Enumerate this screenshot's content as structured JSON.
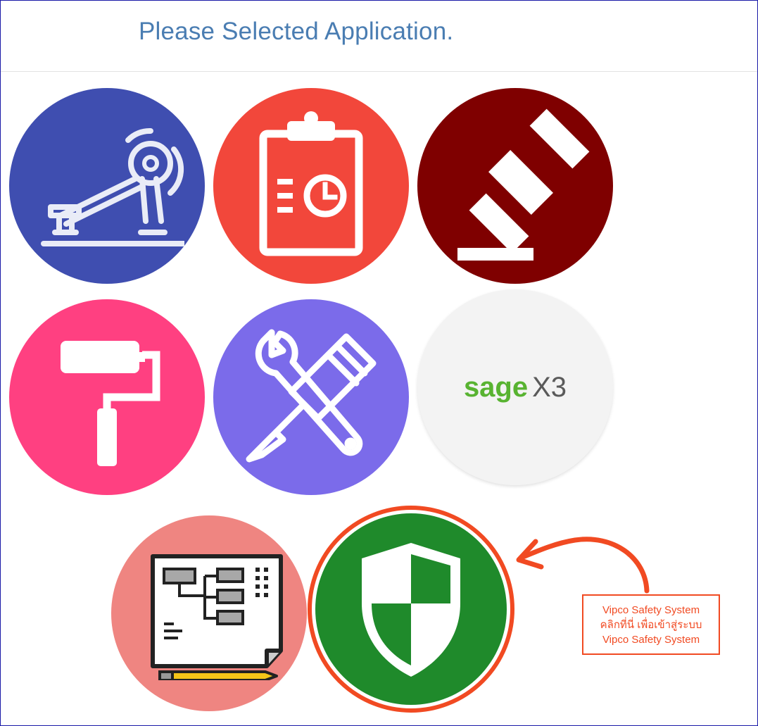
{
  "header": {
    "title": "Please Selected Application."
  },
  "apps": [
    {
      "icon": "rowing-machine-icon",
      "color": "#3f4eb0"
    },
    {
      "icon": "clipboard-clock-icon",
      "color": "#f2473b"
    },
    {
      "icon": "gavel-icon",
      "color": "#7f0000"
    },
    {
      "icon": "paint-roller-icon",
      "color": "#ff4081"
    },
    {
      "icon": "wrench-screwdriver-icon",
      "color": "#7b6bea"
    },
    {
      "icon": "sage-x3-logo",
      "color": "#f3f3f3",
      "logo_text_1": "sage",
      "logo_text_2": "X3"
    },
    {
      "icon": "blueprint-plan-icon",
      "color": "#ef8581"
    },
    {
      "icon": "shield-icon",
      "color": "#1f8a2b",
      "ring_color": "#f14a22"
    }
  ],
  "callout": {
    "line1": "Vipco Safety System",
    "line2": "คลิกที่นี่ เพื่อเข้าสู่ระบบ",
    "line3": "Vipco Safety System",
    "color": "#f14a22"
  }
}
